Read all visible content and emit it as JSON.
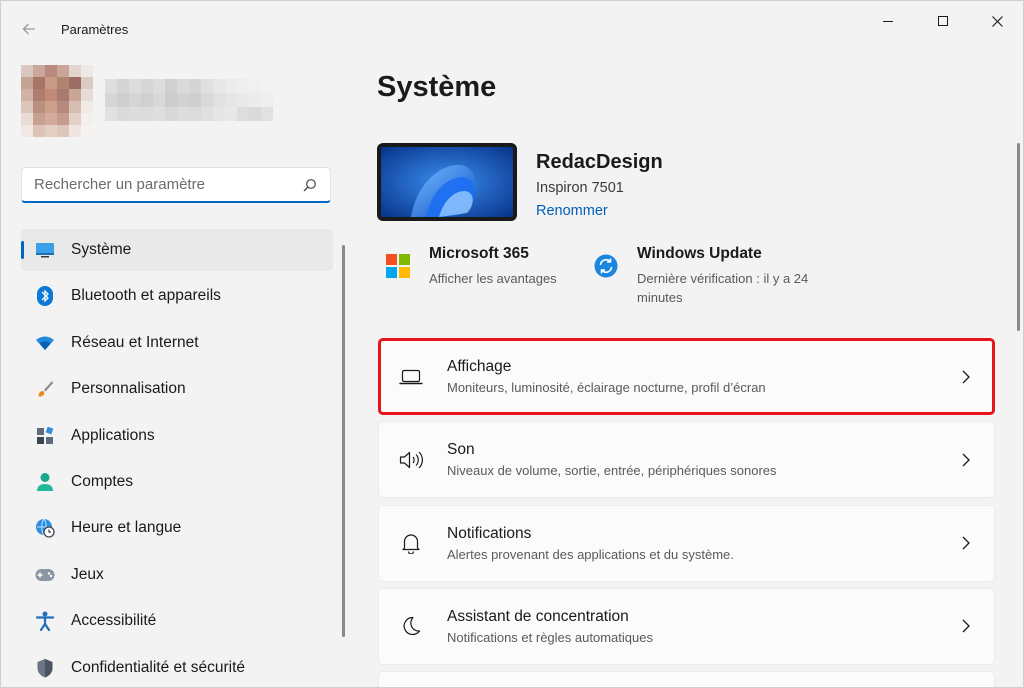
{
  "app": {
    "title": "Paramètres"
  },
  "search": {
    "placeholder": "Rechercher un paramètre"
  },
  "sidebar": {
    "items": [
      {
        "label": "Système",
        "icon": "monitor-icon",
        "active": true
      },
      {
        "label": "Bluetooth et appareils",
        "icon": "bluetooth-icon"
      },
      {
        "label": "Réseau et Internet",
        "icon": "wifi-icon"
      },
      {
        "label": "Personnalisation",
        "icon": "paintbrush-icon"
      },
      {
        "label": "Applications",
        "icon": "apps-icon"
      },
      {
        "label": "Comptes",
        "icon": "person-icon"
      },
      {
        "label": "Heure et langue",
        "icon": "globe-clock-icon"
      },
      {
        "label": "Jeux",
        "icon": "gamepad-icon"
      },
      {
        "label": "Accessibilité",
        "icon": "accessibility-icon"
      },
      {
        "label": "Confidentialité et sécurité",
        "icon": "shield-icon"
      }
    ]
  },
  "main": {
    "title": "Système",
    "device": {
      "name": "RedacDesign",
      "model": "Inspiron 7501",
      "rename_label": "Renommer"
    },
    "quick": [
      {
        "title": "Microsoft 365",
        "subtitle": "Afficher les avantages",
        "icon": "microsoft-logo-icon"
      },
      {
        "title": "Windows Update",
        "subtitle": "Dernière vérification : il y a 24 minutes",
        "icon": "windows-update-icon"
      }
    ],
    "cards": [
      {
        "title": "Affichage",
        "subtitle": "Moniteurs, luminosité, éclairage nocturne, profil d’écran",
        "icon": "laptop-icon",
        "highlighted": true
      },
      {
        "title": "Son",
        "subtitle": "Niveaux de volume, sortie, entrée, périphériques sonores",
        "icon": "speaker-icon"
      },
      {
        "title": "Notifications",
        "subtitle": "Alertes provenant des applications et du système.",
        "icon": "bell-icon"
      },
      {
        "title": "Assistant de concentration",
        "subtitle": "Notifications et règles automatiques",
        "icon": "moon-icon"
      }
    ]
  },
  "colors": {
    "accent": "#0067c0",
    "highlight_border": "#e8141c",
    "link": "#005fb8"
  }
}
